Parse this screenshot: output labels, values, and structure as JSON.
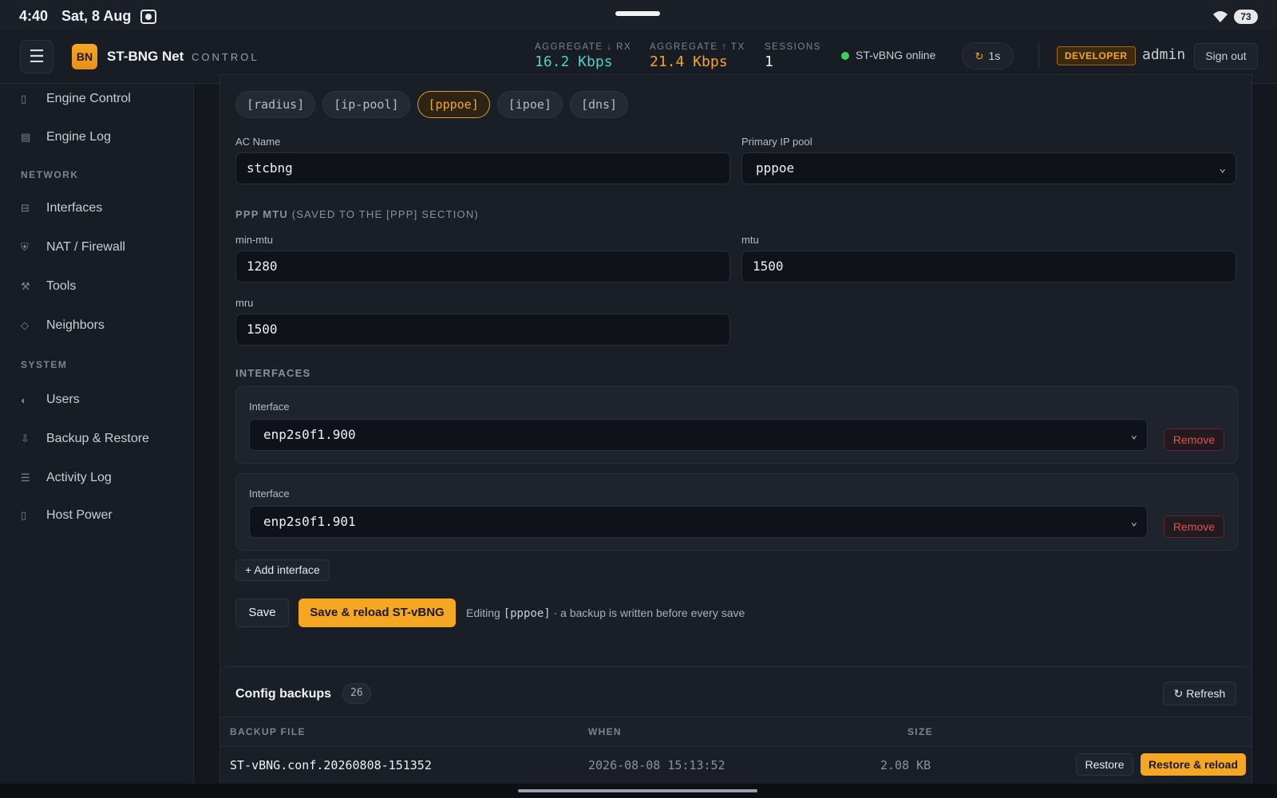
{
  "status_bar": {
    "time": "4:40",
    "date": "Sat, 8 Aug",
    "battery": "73"
  },
  "header": {
    "logo": "BN",
    "brand": "ST-BNG Net",
    "brand_sub": "CONTROL",
    "stats": [
      {
        "label": "AGGREGATE ↓ RX",
        "value": "16.2 Kbps"
      },
      {
        "label": "AGGREGATE ↑ TX",
        "value": "21.4 Kbps"
      },
      {
        "label": "SESSIONS",
        "value": "1"
      }
    ],
    "online_status": "ST-vBNG online",
    "refresh_interval": "1s",
    "role_badge": "DEVELOPER",
    "user": "admin",
    "sign_out": "Sign out",
    "colors": {
      "accent": "#f5a623",
      "rx": "#4fd1c5",
      "online": "#3ecf5c"
    }
  },
  "sidebar": {
    "top_items": [
      {
        "label": "Engine Control",
        "icon": "engine-icon"
      },
      {
        "label": "Engine Log",
        "icon": "log-icon"
      }
    ],
    "network_title": "NETWORK",
    "network_items": [
      {
        "label": "Interfaces",
        "icon": "interfaces-icon"
      },
      {
        "label": "NAT / Firewall",
        "icon": "shield-icon"
      },
      {
        "label": "Tools",
        "icon": "tools-icon"
      },
      {
        "label": "Neighbors",
        "icon": "diamond-icon"
      }
    ],
    "system_title": "SYSTEM",
    "system_items": [
      {
        "label": "Users",
        "icon": "users-icon"
      },
      {
        "label": "Backup & Restore",
        "icon": "backup-icon"
      },
      {
        "label": "Activity Log",
        "icon": "list-icon"
      },
      {
        "label": "Host Power",
        "icon": "power-icon"
      }
    ]
  },
  "config": {
    "tabs": [
      "[radius]",
      "[ip-pool]",
      "[pppoe]",
      "[ipoe]",
      "[dns]"
    ],
    "active_tab": "[pppoe]",
    "ac_name_label": "AC Name",
    "ac_name_value": "stcbng",
    "primary_pool_label": "Primary IP pool",
    "primary_pool_value": "pppoe",
    "ppp_mtu_title": "PPP MTU",
    "ppp_mtu_note": "(SAVED TO THE [PPP] SECTION)",
    "min_mtu_label": "min-mtu",
    "min_mtu_value": "1280",
    "mtu_label": "mtu",
    "mtu_value": "1500",
    "mru_label": "mru",
    "mru_value": "1500",
    "interfaces_title": "INTERFACES",
    "interfaces": [
      {
        "label": "Interface",
        "value": "enp2s0f1.900",
        "remove": "Remove"
      },
      {
        "label": "Interface",
        "value": "enp2s0f1.901",
        "remove": "Remove"
      }
    ],
    "add_interface": "+ Add interface",
    "save": "Save",
    "save_reload": "Save & reload ST-vBNG",
    "note_prefix": "Editing",
    "note_section": "[pppoe]",
    "note_suffix": "· a backup is written before every save"
  },
  "backups": {
    "title": "Config backups",
    "count": "26",
    "refresh": "Refresh",
    "columns": [
      "BACKUP FILE",
      "WHEN",
      "SIZE"
    ],
    "rows": [
      {
        "file": "ST-vBNG.conf.20260808-151352",
        "when": "2026-08-08 15:13:52",
        "size": "2.08 KB",
        "restore": "Restore",
        "restore_reload": "Restore & reload"
      }
    ]
  }
}
